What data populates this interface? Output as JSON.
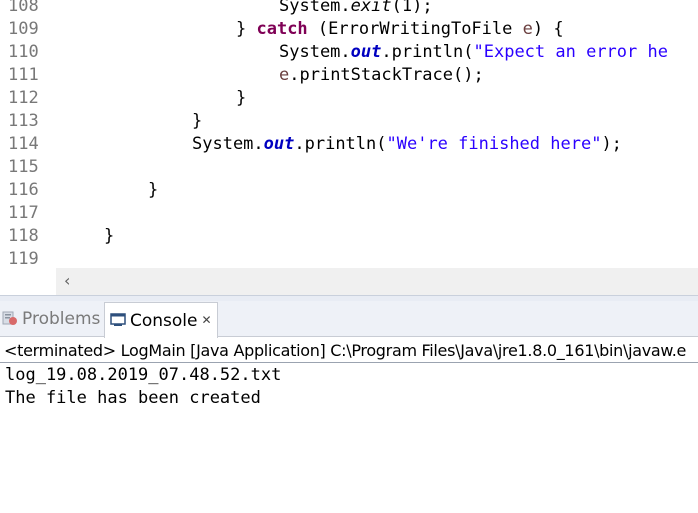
{
  "editor": {
    "line_numbers": [
      "108",
      "109",
      "110",
      "111",
      "112",
      "113",
      "114",
      "115",
      "116",
      "117",
      "118",
      "119"
    ],
    "lines": {
      "l108": {
        "a": "System.",
        "b": "exit",
        "c": "(1);"
      },
      "l109": {
        "a": "} ",
        "b": "catch",
        "c": " (ErrorWritingToFile ",
        "d": "e",
        "e": ") {"
      },
      "l110": {
        "a": "System.",
        "b": "out",
        "c": ".println(",
        "d": "\"Expect an error he"
      },
      "l111": {
        "a": "e",
        "b": ".printStackTrace();"
      },
      "l112": "}",
      "l113": "}",
      "l114": {
        "a": "System.",
        "b": "out",
        "c": ".println(",
        "d": "\"We're finished here\"",
        "e": ");"
      },
      "l116": "}",
      "l118": "}"
    }
  },
  "scrollbar": {
    "left_arrow": "‹"
  },
  "views": {
    "tabs": [
      {
        "label": "Problems",
        "icon": "problems-icon",
        "active": false
      },
      {
        "label": "Console",
        "icon": "console-icon",
        "active": true,
        "close": "✕"
      }
    ]
  },
  "console": {
    "status": "<terminated> LogMain [Java Application] C:\\Program Files\\Java\\jre1.8.0_161\\bin\\javaw.e",
    "output": [
      "log_19.08.2019_07.48.52.txt",
      "The file has been created"
    ]
  },
  "colors": {
    "keyword": "#7f0055",
    "string": "#2a00ff",
    "field": "#0000c0",
    "line_number": "#787878"
  }
}
